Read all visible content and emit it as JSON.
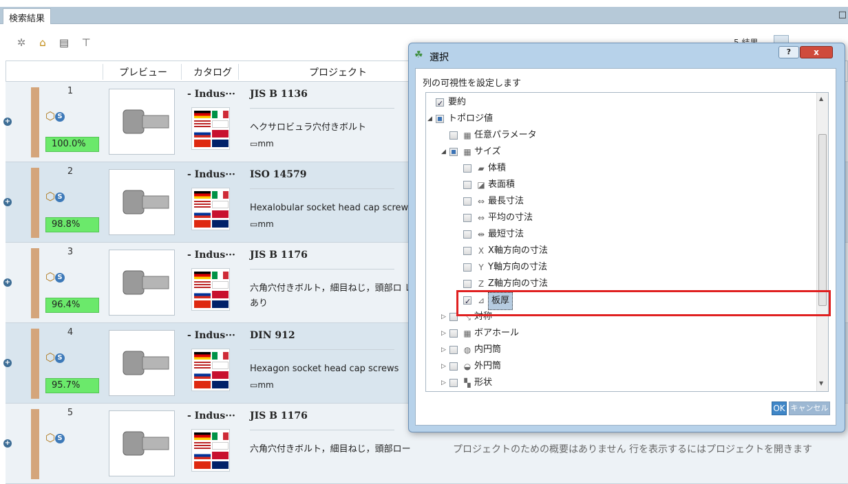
{
  "tab": {
    "label": "検索結果",
    "close": "□"
  },
  "toolbar": {
    "results": "5 結果",
    "icons": [
      "gear-icon",
      "home-star-icon",
      "export-table-icon",
      "filter-icon"
    ]
  },
  "table": {
    "headers": {
      "preview": "プレビュー",
      "catalog": "カタログ",
      "project": "プロジェクト"
    },
    "rows": [
      {
        "num": "1",
        "score": "100.0%",
        "catalog": "- Indus···",
        "title": "JIS B 1136",
        "desc": "ヘクサロビュラ穴付きボルト",
        "unit": "mm",
        "score_color": "#6be96b"
      },
      {
        "num": "2",
        "score": "98.8%",
        "catalog": "- Indus···",
        "title": "ISO 14579",
        "desc": "Hexalobular socket head cap screws",
        "unit": "mm",
        "score_color": "#6be96b"
      },
      {
        "num": "3",
        "score": "96.4%",
        "catalog": "- Indus···",
        "title": "JIS B 1176",
        "desc": "六角穴付きボルト，細目ねじ，頭部ロ レットあり",
        "unit": "",
        "score_color": "#6be96b"
      },
      {
        "num": "4",
        "score": "95.7%",
        "catalog": "- Indus···",
        "title": "DIN 912",
        "desc": "Hexagon socket head cap screws",
        "unit": "mm",
        "score_color": "#6be96b"
      },
      {
        "num": "5",
        "score": "",
        "catalog": "- Indus···",
        "title": "JIS B 1176",
        "desc": "六角穴付きボルト，細目ねじ，頭部ロー",
        "unit": "",
        "score_color": "#6be96b"
      }
    ],
    "summary_note": "プロジェクトのための概要はありません 行を表示するにはプロジェクトを開きます"
  },
  "dialog": {
    "title": "選択",
    "help": "?",
    "close": "x",
    "subtitle": "列の可視性を設定します",
    "tree": [
      {
        "label": "要約",
        "state": "checked",
        "level": 0,
        "tri": "",
        "icon": ""
      },
      {
        "label": "トポロジ値",
        "state": "partial",
        "level": 0,
        "tri": "◢",
        "icon": ""
      },
      {
        "label": "任意パラメータ",
        "state": "unchecked",
        "level": 1,
        "tri": "",
        "icon": "▦"
      },
      {
        "label": "サイズ",
        "state": "partial",
        "level": 1,
        "tri": "◢",
        "icon": "▦"
      },
      {
        "label": "体積",
        "state": "unchecked",
        "level": 2,
        "tri": "",
        "icon": "▰"
      },
      {
        "label": "表面積",
        "state": "unchecked",
        "level": 2,
        "tri": "",
        "icon": "◪"
      },
      {
        "label": "最長寸法",
        "state": "unchecked",
        "level": 2,
        "tri": "",
        "icon": "⇔"
      },
      {
        "label": "平均の寸法",
        "state": "unchecked",
        "level": 2,
        "tri": "",
        "icon": "⇔"
      },
      {
        "label": "最短寸法",
        "state": "unchecked",
        "level": 2,
        "tri": "",
        "icon": "⇹"
      },
      {
        "label": "X軸方向の寸法",
        "state": "unchecked",
        "level": 2,
        "tri": "",
        "icon": "X"
      },
      {
        "label": "Y軸方向の寸法",
        "state": "unchecked",
        "level": 2,
        "tri": "",
        "icon": "Y"
      },
      {
        "label": "Z軸方向の寸法",
        "state": "unchecked",
        "level": 2,
        "tri": "",
        "icon": "Z"
      },
      {
        "label": "板厚",
        "state": "checked",
        "level": 2,
        "tri": "",
        "icon": "⊿",
        "selected": true
      },
      {
        "label": "対称",
        "state": "unchecked",
        "level": 1,
        "tri": "▷",
        "icon": "⤡"
      },
      {
        "label": "ボアホール",
        "state": "unchecked",
        "level": 1,
        "tri": "▷",
        "icon": "▦"
      },
      {
        "label": "内円筒",
        "state": "unchecked",
        "level": 1,
        "tri": "▷",
        "icon": "◍"
      },
      {
        "label": "外円筒",
        "state": "unchecked",
        "level": 1,
        "tri": "▷",
        "icon": "◒"
      },
      {
        "label": "形状",
        "state": "unchecked",
        "level": 1,
        "tri": "▷",
        "icon": "▚"
      }
    ],
    "ok": "OK",
    "cancel": "キャンセル"
  }
}
